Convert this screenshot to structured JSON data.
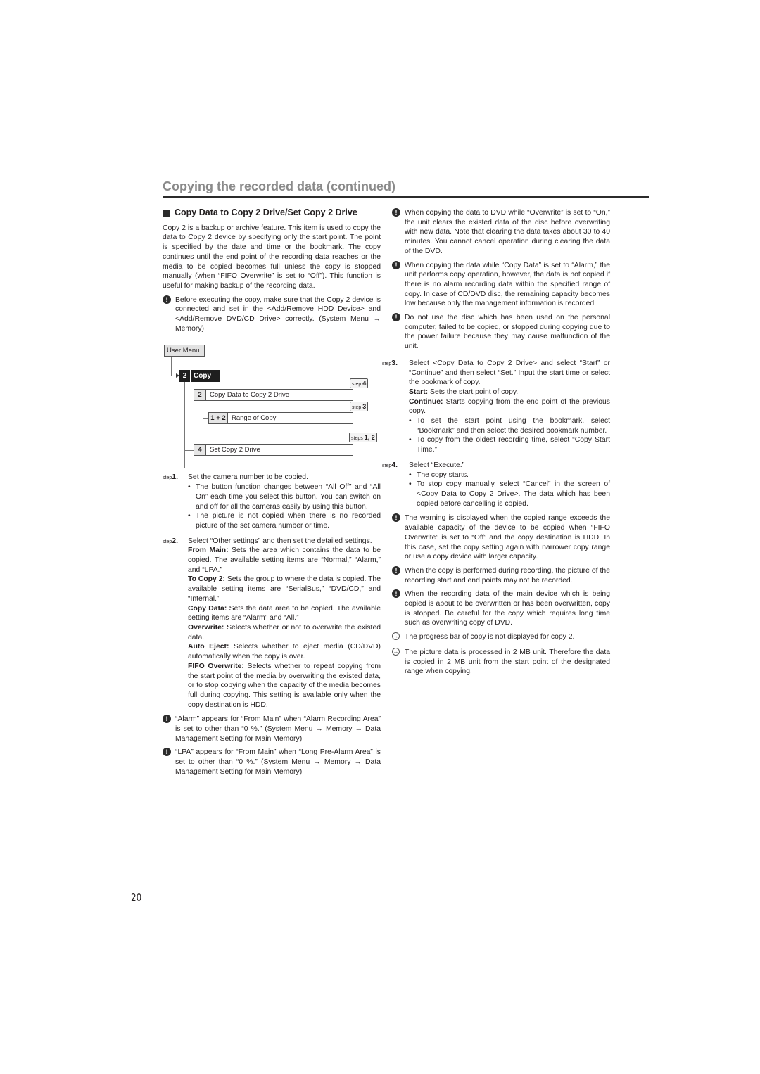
{
  "header": {
    "title": "Copying the recorded data (continued)"
  },
  "section": {
    "heading": "Copy Data to Copy 2 Drive/Set Copy 2 Drive",
    "intro": "Copy 2 is a backup or archive feature. This item is used to copy the data to Copy 2 device by specifying only the start point. The point is specified by the date and time or the bookmark. The copy continues until the end point of the recording data reaches or the media to be copied becomes full unless the copy is stopped manually (when “FIFO Overwrite” is set to “Off”). This function is useful for making backup of the recording data.",
    "note_before": "Before executing the copy, make sure that the Copy 2 device is connected and set in the <Add/Remove HDD Device> and <Add/Remove DVD/CD Drive> correctly. (System Menu → Memory)"
  },
  "diagram": {
    "user_menu": "User Menu",
    "copy_num": "2",
    "copy_label": "Copy",
    "items": [
      {
        "num": "2",
        "label": "Copy Data to Copy 2 Drive",
        "callout_prefix": "step",
        "callout_num": "4"
      },
      {
        "num": "1 + 2",
        "label": "Range of Copy",
        "callout_prefix": "step",
        "callout_num": "3"
      },
      {
        "num": "4",
        "label": "Set Copy 2 Drive",
        "callout_prefix": "steps",
        "callout_num": "1, 2"
      }
    ]
  },
  "steps": {
    "step_word": "step",
    "s1": {
      "num": "1.",
      "text": "Set the camera number to be copied.",
      "bullets": [
        "The button function changes between “All Off” and “All On” each time you select this button. You can switch on and off for all the cameras easily by using this button.",
        "The picture is not copied when there is no recorded picture of the set camera number or time."
      ]
    },
    "s2": {
      "num": "2.",
      "text": "Select “Other settings” and then set the detailed settings.",
      "items": [
        {
          "term": "From Main:",
          "desc": "Sets the area which contains the data to be copied. The available setting items are “Normal,” “Alarm,” and “LPA.”"
        },
        {
          "term": "To Copy 2:",
          "desc": "Sets the group to where the data is copied. The available setting items are “SerialBus,” “DVD/CD,” and “Internal.”"
        },
        {
          "term": "Copy Data:",
          "desc": "Sets the data area to be copied. The available setting items are “Alarm” and “All.”"
        },
        {
          "term": "Overwrite:",
          "desc": "Selects whether or not to overwrite the existed data."
        },
        {
          "term": "Auto Eject:",
          "desc": "Selects whether to eject media (CD/DVD) automatically when the copy is over."
        },
        {
          "term": "FIFO Overwrite:",
          "desc": "Selects whether to repeat copying from the start point of the media by overwriting the existed data, or to stop copying when the capacity of the media becomes full during copying. This setting is available only when the copy destination is HDD."
        }
      ]
    },
    "s3": {
      "num": "3.",
      "text": "Select <Copy Data to Copy 2 Drive> and select “Start” or “Continue” and then select “Set.” Input the start time or select the bookmark of copy.",
      "items": [
        {
          "term": "Start:",
          "desc": "Sets the start point of copy."
        },
        {
          "term": "Continue:",
          "desc": "Starts copying from the end point of the previous copy."
        }
      ],
      "bullets": [
        "To set the start point using the bookmark, select “Bookmark” and then select the desired bookmark number.",
        "To copy from the oldest recording time, select “Copy Start Time.”"
      ]
    },
    "s4": {
      "num": "4.",
      "text": "Select “Execute.”",
      "bullets": [
        "The copy starts.",
        "To stop copy manually, select “Cancel” in the screen of <Copy Data to Copy 2 Drive>. The data which has been copied before cancelling is copied."
      ]
    }
  },
  "notes_left": [
    "“Alarm” appears for “From Main” when “Alarm Recording Area” is set to other than “0 %.” (System Menu → Memory → Data Management Setting for Main Memory)",
    "“LPA” appears for “From Main” when “Long Pre-Alarm Area” is set to other than “0 %.” (System Menu → Memory → Data Management Setting for Main Memory)"
  ],
  "notes_right_top": [
    "When copying the data to DVD while “Overwrite” is set to “On,” the unit clears the existed data of the disc before overwriting with new data. Note that clearing the data takes about 30 to 40 minutes. You cannot cancel operation during clearing the data of the DVD.",
    "When copying the data while “Copy Data” is set to “Alarm,” the unit performs copy operation, however, the data is not copied if there is no alarm recording data within the specified range of copy. In case of CD/DVD disc, the remaining capacity becomes low because only the management information is recorded.",
    "Do not use the disc which has been used on the personal computer, failed to be copied, or stopped during copying due to the power failure because they may cause malfunction of the unit."
  ],
  "notes_right_bottom": [
    "The warning is displayed when the copied range exceeds the available capacity of the device to be copied when “FIFO Overwrite” is set to “Off” and the copy destination is HDD. In this case, set the copy setting again with narrower copy range or use a copy device with larger capacity.",
    "When the copy is performed during recording, the picture of the recording start and end points may not be recorded.",
    "When the recording data of the main device which is being copied is about to be overwritten or has been overwritten, copy is stopped. Be careful for the copy which requires long time such as overwriting copy of DVD."
  ],
  "info_notes": [
    "The progress bar of copy is not displayed for copy 2.",
    "The picture data is processed in 2 MB unit. Therefore the data is copied in 2 MB unit from the start point of the designated range when copying."
  ],
  "icons": {
    "caution": "!",
    "info": "→"
  },
  "footer": {
    "page_number": "20"
  }
}
